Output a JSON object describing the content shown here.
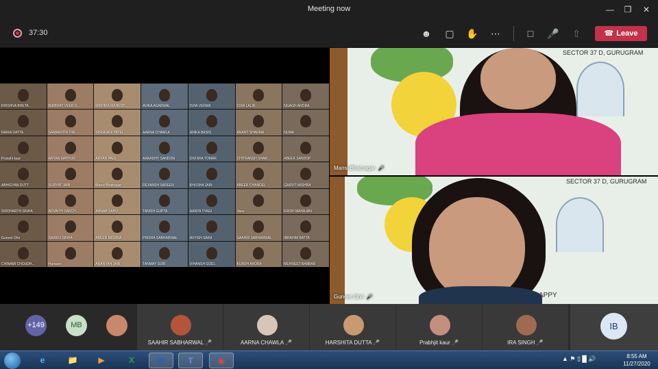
{
  "window": {
    "title": "Meeting now"
  },
  "toolbar": {
    "timer": "37:30",
    "leave_label": "Leave"
  },
  "grid_names": [
    "KRISHNA BHETA...",
    "NIRBHAY VEER D...",
    "MISHIKA MAHESH...",
    "AVIKA AGARWAL",
    "ISHA VERMA",
    "CIRA LALIN",
    "NGAGH ARORA",
    "NAIRA DATTA",
    "SAMANVITA TIW...",
    "SHRAVANI PATEL",
    "AARNA CHAWLA",
    "ANIKA BASIN",
    "ANANT SHARMA",
    "NUMA",
    "Pranshi kaur",
    "ARYAN MATHUR",
    "ARYAN PAUL",
    "AARADHY SANDON",
    "DIVISHA TOMAR",
    "CHITRANSH SHAR...",
    "ABEEK SANDOP",
    "ABHIGYAN DUTT",
    "SURYAT JAIN",
    "Mansi Bhatnagar",
    "REYANSH SAREEN",
    "KHUSHA JAIN",
    "ABEER CHANDEL",
    "GARVIT MISHRA",
    "SIDDHARTH SINHA",
    "ADVAITH SARCH...",
    "ARNAB SAHU",
    "TANISH GUPTA",
    "AANYA TYAGI",
    "Vasu",
    "KRISH MAHAJAN",
    "Guneet Ohri",
    "SAANVI SINHA",
    "ABEER MISHRA",
    "PRISHA SABHARWAL",
    "AVYISH SAINI",
    "SAAHIR SABHARWAL",
    "IBRAHIM BATTA",
    "CHINAMI CHOUDH...",
    "Harsaee",
    "ANANYAH JAIN",
    "TANMAY SURI",
    "VIHANSH GOEL",
    "KUNSH ARORA",
    "MEHREET BABBAR"
  ],
  "videos": {
    "top": {
      "name": "Mansi Bhatnagar",
      "caption": "SECTOR 37 D, GURUGRAM"
    },
    "bottom": {
      "name": "Guneet Ohri",
      "caption": "SECTOR 37 D, GURUGRAM",
      "corner_text": "APPY"
    }
  },
  "participants": {
    "overflow": "+149",
    "initials_1": "MB",
    "cards": [
      "SAAHIR SABHARWAL",
      "AARNA CHAWLA",
      "HARSHITA DUTTA",
      "Prabhjit kaur",
      "IRA SINGH"
    ],
    "initials_last": "IB"
  },
  "taskbar": {
    "time": "8:55 AM",
    "date": "11/27/2020"
  },
  "colors": {
    "leave": "#c4314b",
    "accent": "#6264a7",
    "toolbar_bg": "#1f1f1f",
    "taskbar": "#1a3556"
  }
}
